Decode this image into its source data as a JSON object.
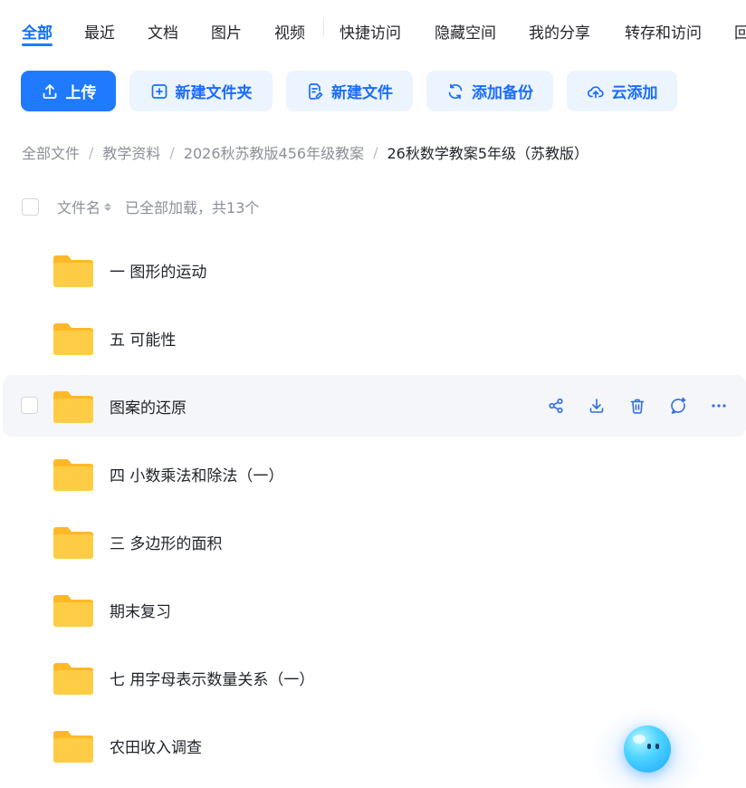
{
  "tabs": [
    {
      "label": "全部",
      "active": true
    },
    {
      "label": "最近"
    },
    {
      "label": "文档"
    },
    {
      "label": "图片"
    },
    {
      "label": "视频"
    },
    {
      "label": "快捷访问"
    },
    {
      "label": "隐藏空间"
    },
    {
      "label": "我的分享"
    },
    {
      "label": "转存和访问"
    },
    {
      "label": "回"
    }
  ],
  "toolbar": {
    "upload": {
      "label": "上传",
      "icon": "upload-icon"
    },
    "new_folder": {
      "label": "新建文件夹",
      "icon": "folder-plus-icon"
    },
    "new_file": {
      "label": "新建文件",
      "icon": "file-edit-icon"
    },
    "add_backup": {
      "label": "添加备份",
      "icon": "sync-icon"
    },
    "cloud_add": {
      "label": "云添加",
      "icon": "cloud-upload-icon"
    }
  },
  "breadcrumb": [
    "全部文件",
    "教学资料",
    "2026秋苏教版456年级教案",
    "26秋数学教案5年级（苏教版）"
  ],
  "list": {
    "sort_label": "文件名",
    "status": "已全部加载，共13个"
  },
  "files": [
    {
      "name": "一 图形的运动"
    },
    {
      "name": "五 可能性"
    },
    {
      "name": "图案的还原"
    },
    {
      "name": "四 小数乘法和除法（一）"
    },
    {
      "name": "三 多边形的面积"
    },
    {
      "name": "期末复习"
    },
    {
      "name": "七 用字母表示数量关系（一）"
    },
    {
      "name": "农田收入调查"
    }
  ],
  "row_actions": [
    "share-icon",
    "download-icon",
    "delete-icon",
    "ai-chat-icon",
    "more-icon"
  ],
  "colors": {
    "accent": "#1f7aff",
    "accent_light": "#ecf4ff",
    "folder": "#ffc93a"
  }
}
